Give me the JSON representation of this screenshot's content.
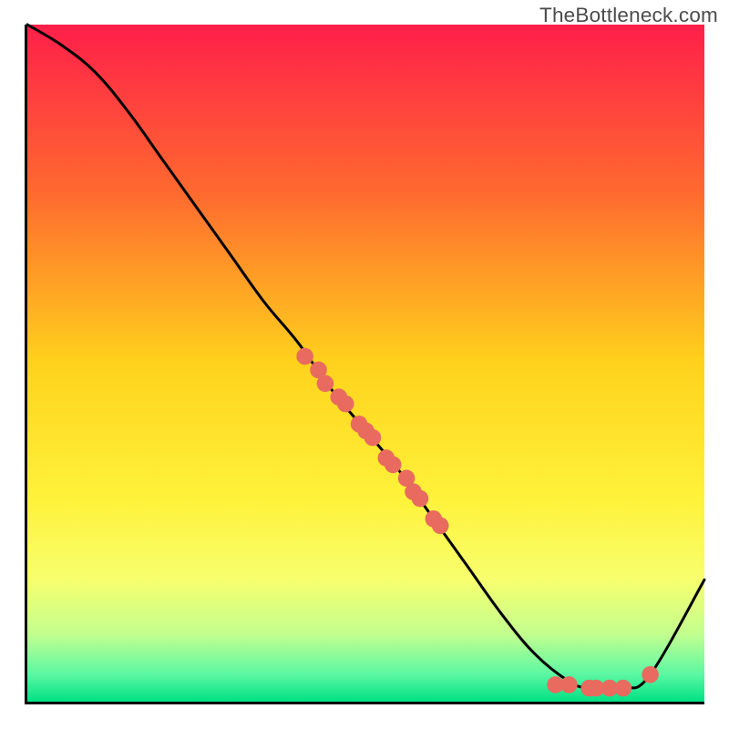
{
  "watermark": "TheBottleneck.com",
  "chart_data": {
    "type": "line",
    "title": "",
    "xlabel": "",
    "ylabel": "",
    "xlim": [
      0,
      100
    ],
    "ylim": [
      0,
      100
    ],
    "grid": false,
    "legend": false,
    "gradient_stops": [
      {
        "offset": 0,
        "color": "#ff1f4a"
      },
      {
        "offset": 0.25,
        "color": "#ff6a2f"
      },
      {
        "offset": 0.5,
        "color": "#ffd21c"
      },
      {
        "offset": 0.7,
        "color": "#fff23a"
      },
      {
        "offset": 0.82,
        "color": "#f7ff6e"
      },
      {
        "offset": 0.9,
        "color": "#c3ff8f"
      },
      {
        "offset": 0.96,
        "color": "#5bf7a3"
      },
      {
        "offset": 1.0,
        "color": "#00e184"
      }
    ],
    "curve": {
      "name": "bottleneck-curve",
      "x": [
        0,
        5,
        10,
        15,
        20,
        25,
        30,
        35,
        40,
        45,
        50,
        55,
        60,
        65,
        70,
        75,
        80,
        83,
        88,
        92,
        100
      ],
      "y": [
        100,
        97,
        93,
        87,
        80,
        73,
        66,
        59,
        53,
        46,
        40,
        34,
        27,
        20,
        13,
        7,
        3,
        2,
        2,
        4,
        18
      ]
    },
    "marker_series": {
      "name": "highlight-points",
      "color": "#e96a5f",
      "points": [
        {
          "x": 41,
          "y": 51
        },
        {
          "x": 43,
          "y": 49
        },
        {
          "x": 44,
          "y": 47
        },
        {
          "x": 46,
          "y": 45
        },
        {
          "x": 47,
          "y": 44
        },
        {
          "x": 49,
          "y": 41
        },
        {
          "x": 50,
          "y": 40
        },
        {
          "x": 51,
          "y": 39
        },
        {
          "x": 53,
          "y": 36
        },
        {
          "x": 54,
          "y": 35
        },
        {
          "x": 56,
          "y": 33
        },
        {
          "x": 57,
          "y": 31
        },
        {
          "x": 58,
          "y": 30
        },
        {
          "x": 60,
          "y": 27
        },
        {
          "x": 61,
          "y": 26
        },
        {
          "x": 78,
          "y": 2.5
        },
        {
          "x": 80,
          "y": 2.5
        },
        {
          "x": 83,
          "y": 2
        },
        {
          "x": 84,
          "y": 2
        },
        {
          "x": 86,
          "y": 2
        },
        {
          "x": 88,
          "y": 2
        },
        {
          "x": 92,
          "y": 4
        }
      ]
    }
  }
}
